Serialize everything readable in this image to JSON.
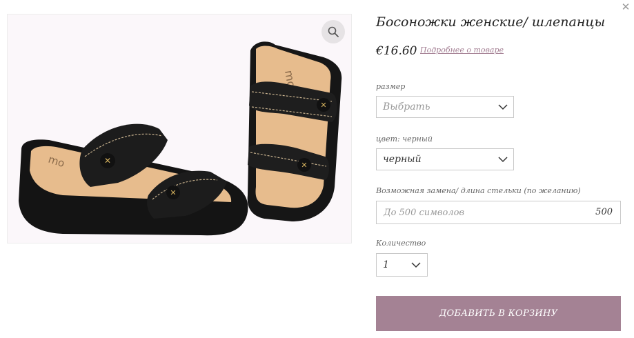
{
  "modal": {
    "close_icon": "close-icon"
  },
  "product": {
    "title": "Босоножки женские/ шлепанцы",
    "price": "€16.60",
    "more_link": "Подробнее о товаре",
    "image_alt": "black leather sandals",
    "brand_imprint": "mo"
  },
  "zoom": {
    "icon": "magnifier-icon"
  },
  "size": {
    "label": "размер",
    "selected": "Выбрать"
  },
  "color": {
    "label": "цвет: черный",
    "selected": "черный"
  },
  "replacement": {
    "label": "Возможная замена/ длина стельки (по желанию)",
    "placeholder": "До 500 символов",
    "counter": "500"
  },
  "quantity": {
    "label": "Количество",
    "selected": "1"
  },
  "cart": {
    "button_label": "ДОБАВИТЬ В КОРЗИНУ"
  },
  "colors": {
    "accent": "#a48294",
    "link": "#a27d91",
    "border": "#c9c9c9"
  }
}
